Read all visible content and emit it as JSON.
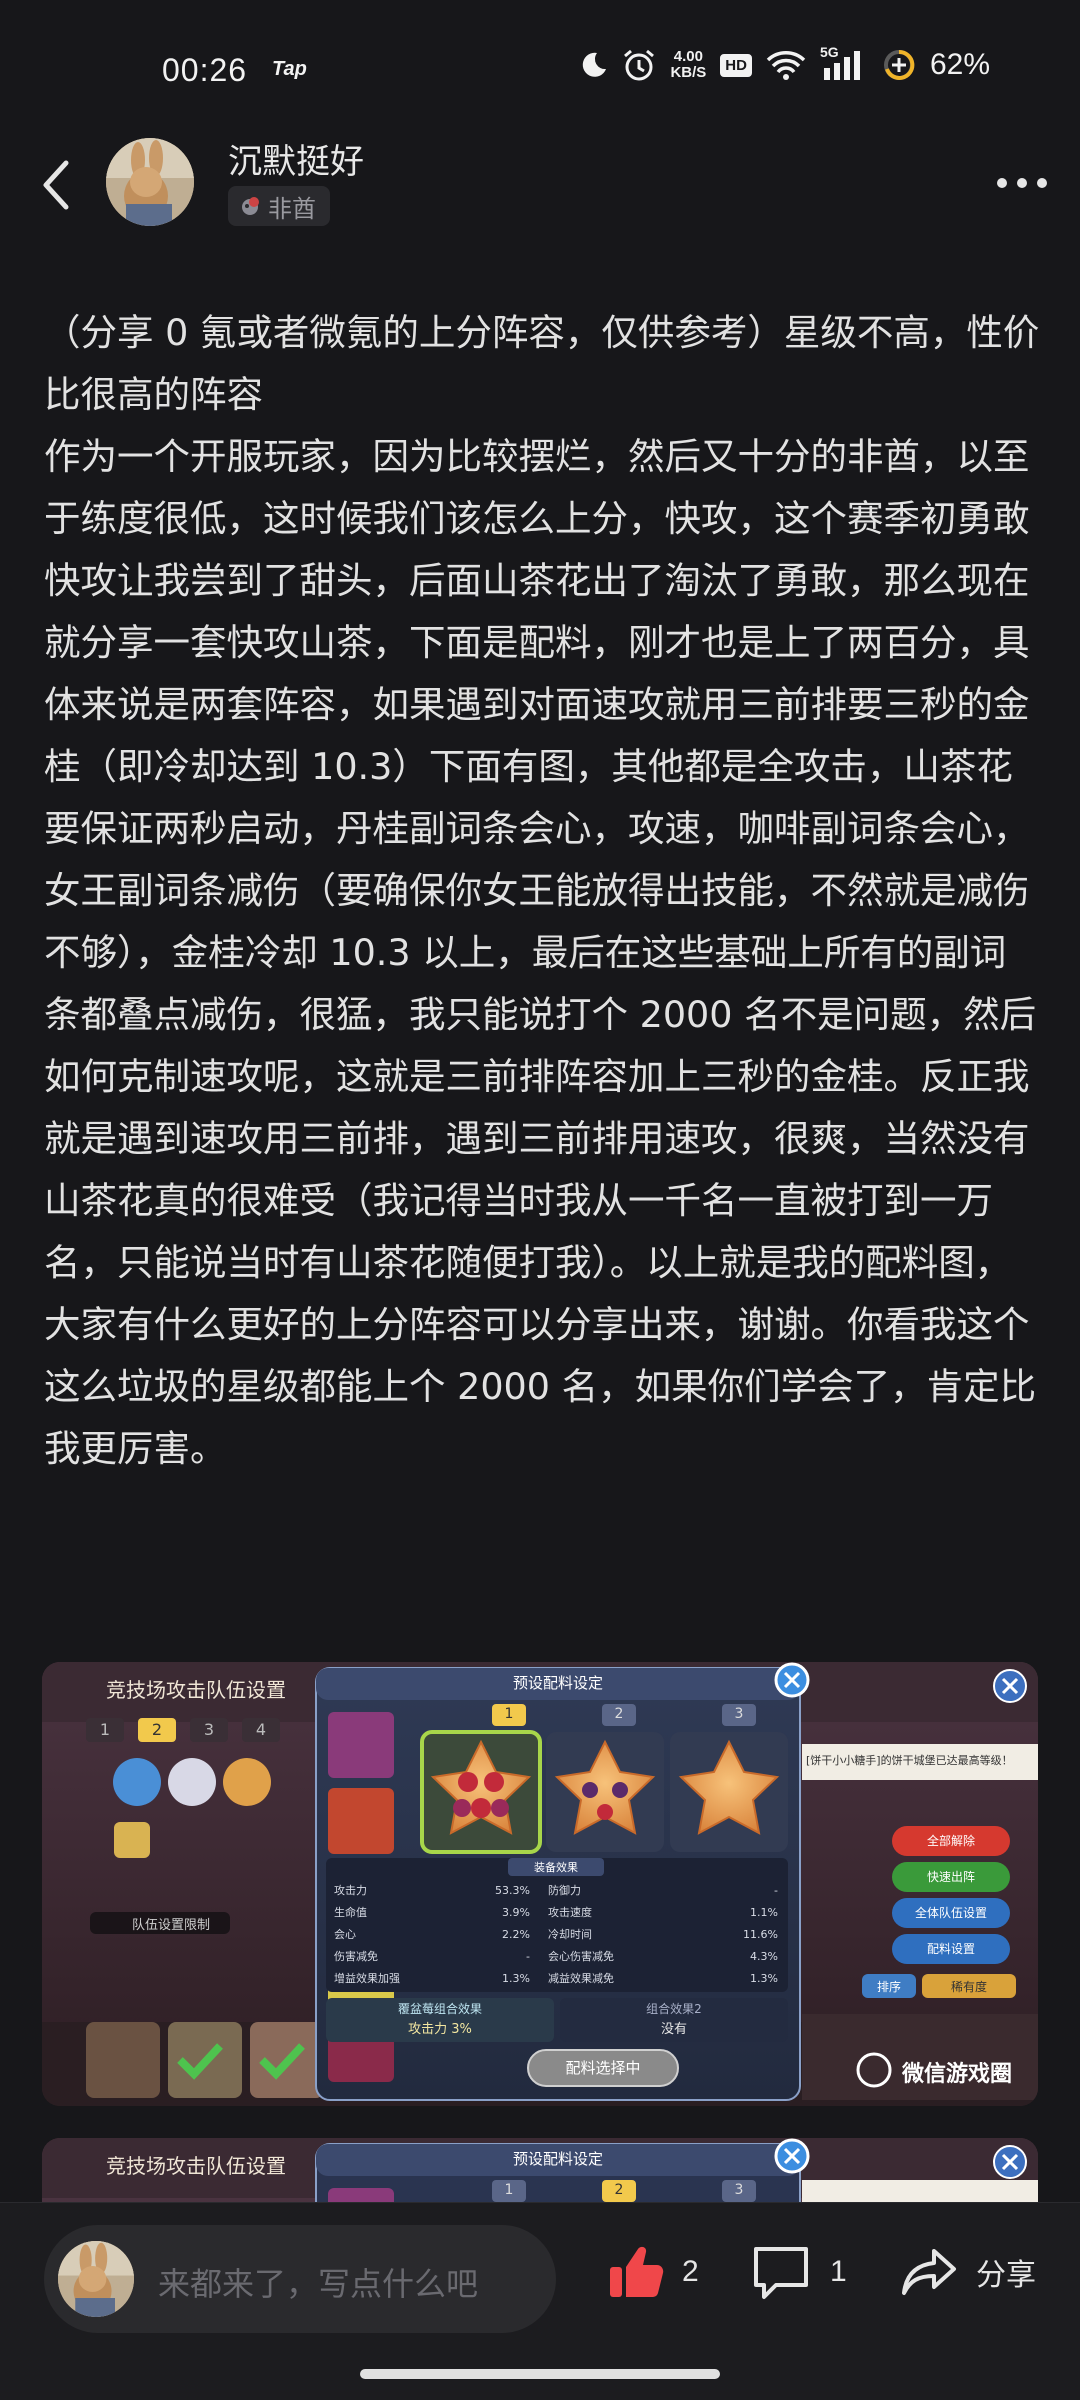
{
  "status_bar": {
    "time": "00:26",
    "app_indicator": "Tap",
    "speed_value": "4.00",
    "speed_unit": "KB/S",
    "hd_label": "HD",
    "network_label": "5G",
    "battery": "62%",
    "icons": [
      "moon-icon",
      "alarm-icon",
      "wifi-icon",
      "signal-icon",
      "battery-icon"
    ]
  },
  "header": {
    "username": "沉默挺好",
    "badge_label": "非酋"
  },
  "post": {
    "body": "（分享 0 氪或者微氪的上分阵容，仅供参考）星级不高，性价比很高的阵容\n作为一个开服玩家，因为比较摆烂，然后又十分的非酋，以至于练度很低，这时候我们该怎么上分，快攻，这个赛季初勇敢快攻让我尝到了甜头，后面山茶花出了淘汰了勇敢，那么现在就分享一套快攻山茶，下面是配料，刚才也是上了两百分，具体来说是两套阵容，如果遇到对面速攻就用三前排要三秒的金桂（即冷却达到 10.3）下面有图，其他都是全攻击，山茶花要保证两秒启动，丹桂副词条会心，攻速，咖啡副词条会心，女王副词条减伤（要确保你女王能放得出技能，不然就是减伤不够），金桂冷却 10.3 以上，最后在这些基础上所有的副词条都叠点减伤，很猛，我只能说打个 2000 名不是问题，然后如何克制速攻呢，这就是三前排阵容加上三秒的金桂。反正我就是遇到速攻用三前排，遇到三前排用速攻，很爽，当然没有山茶花真的很难受（我记得当时我从一千名一直被打到一万名，只能说当时有山茶花随便打我）。以上就是我的配料图，大家有什么更好的上分阵容可以分享出来，谢谢。你看我这个这么垃圾的星级都能上个 2000 名，如果你们学会了，肯定比我更厉害。"
  },
  "screenshot1": {
    "bg_title": "竞技场攻击队伍设置",
    "team_tabs": [
      "1",
      "2",
      "3",
      "4"
    ],
    "team_limit_label": "队伍设置限制",
    "dialog_title": "预设配料设定",
    "slot_tabs": [
      "1",
      "2",
      "3"
    ],
    "effects_title": "装备效果",
    "stats": [
      {
        "name": "攻击力",
        "value": "53.3%",
        "name2": "防御力",
        "value2": "-"
      },
      {
        "name": "生命值",
        "value": "3.9%",
        "name2": "攻击速度",
        "value2": "1.1%"
      },
      {
        "name": "会心",
        "value": "2.2%",
        "name2": "冷却时间",
        "value2": "11.6%"
      },
      {
        "name": "伤害减免",
        "value": "-",
        "name2": "会心伤害减免",
        "value2": "4.3%"
      },
      {
        "name": "增益效果加强",
        "value": "1.3%",
        "name2": "减益效果减免",
        "value2": "1.3%"
      }
    ],
    "combo1_title": "覆盆莓组合效果",
    "combo1_value": "攻击力 3%",
    "combo2_title": "组合效果2",
    "combo2_value": "没有",
    "select_button": "配料选择中",
    "side_buttons": [
      "全部解除",
      "快速出阵",
      "全体队伍设置",
      "配料设置"
    ],
    "notice": "[饼干小小糖手]的饼干城堡已达最高等级！",
    "sort_label": "排序",
    "rarity_label": "稀有度",
    "watermark": "微信游戏圈"
  },
  "screenshot2": {
    "bg_title": "竞技场攻击队伍设置",
    "dialog_title": "预设配料设定",
    "slot_tabs": [
      "1",
      "2",
      "3"
    ]
  },
  "bottom_bar": {
    "comment_placeholder": "来都来了，写点什么吧",
    "like_count": "2",
    "comment_count": "1",
    "share_label": "分享"
  }
}
